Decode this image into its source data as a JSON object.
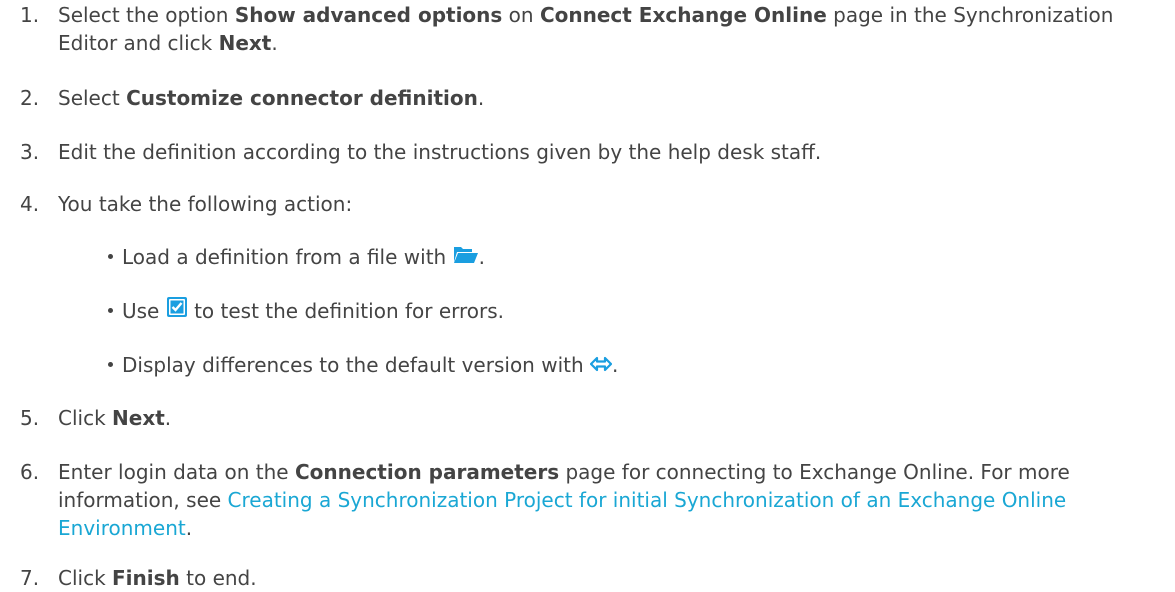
{
  "steps": [
    {
      "num": "1.",
      "parts": [
        "Select the option ",
        "Show advanced options",
        " on ",
        "Connect Exchange Online",
        " page in the Synchronization Editor and click ",
        "Next",
        "."
      ]
    },
    {
      "num": "2.",
      "parts": [
        "Select ",
        "Customize connector definition",
        "."
      ]
    },
    {
      "num": "3.",
      "parts": [
        "Edit the definition according to the instructions given by the help desk staff."
      ]
    },
    {
      "num": "4.",
      "parts": [
        "You take the following action:"
      ],
      "bullets": [
        {
          "before": "Load a definition from a file with ",
          "icon": "folder-open-icon",
          "after": "."
        },
        {
          "before": "Use ",
          "icon": "checkbox-checked-icon",
          "after": " to test the definition for errors."
        },
        {
          "before": "Display differences to the default version with ",
          "icon": "compare-arrows-icon",
          "after": "."
        }
      ]
    },
    {
      "num": "5.",
      "parts": [
        "Click ",
        "Next",
        "."
      ]
    },
    {
      "num": "6.",
      "parts": [
        "Enter login data on the ",
        "Connection parameters",
        " page for connecting to Exchange Online. For more information, see ",
        "Creating a Synchronization Project for initial Synchronization of an Exchange Online Environment",
        "."
      ]
    },
    {
      "num": "7.",
      "parts": [
        "Click ",
        "Finish",
        " to end."
      ]
    }
  ],
  "colors": {
    "text": "#444444",
    "link": "#1aa7d4",
    "icon_blue": "#1a9ee0"
  }
}
